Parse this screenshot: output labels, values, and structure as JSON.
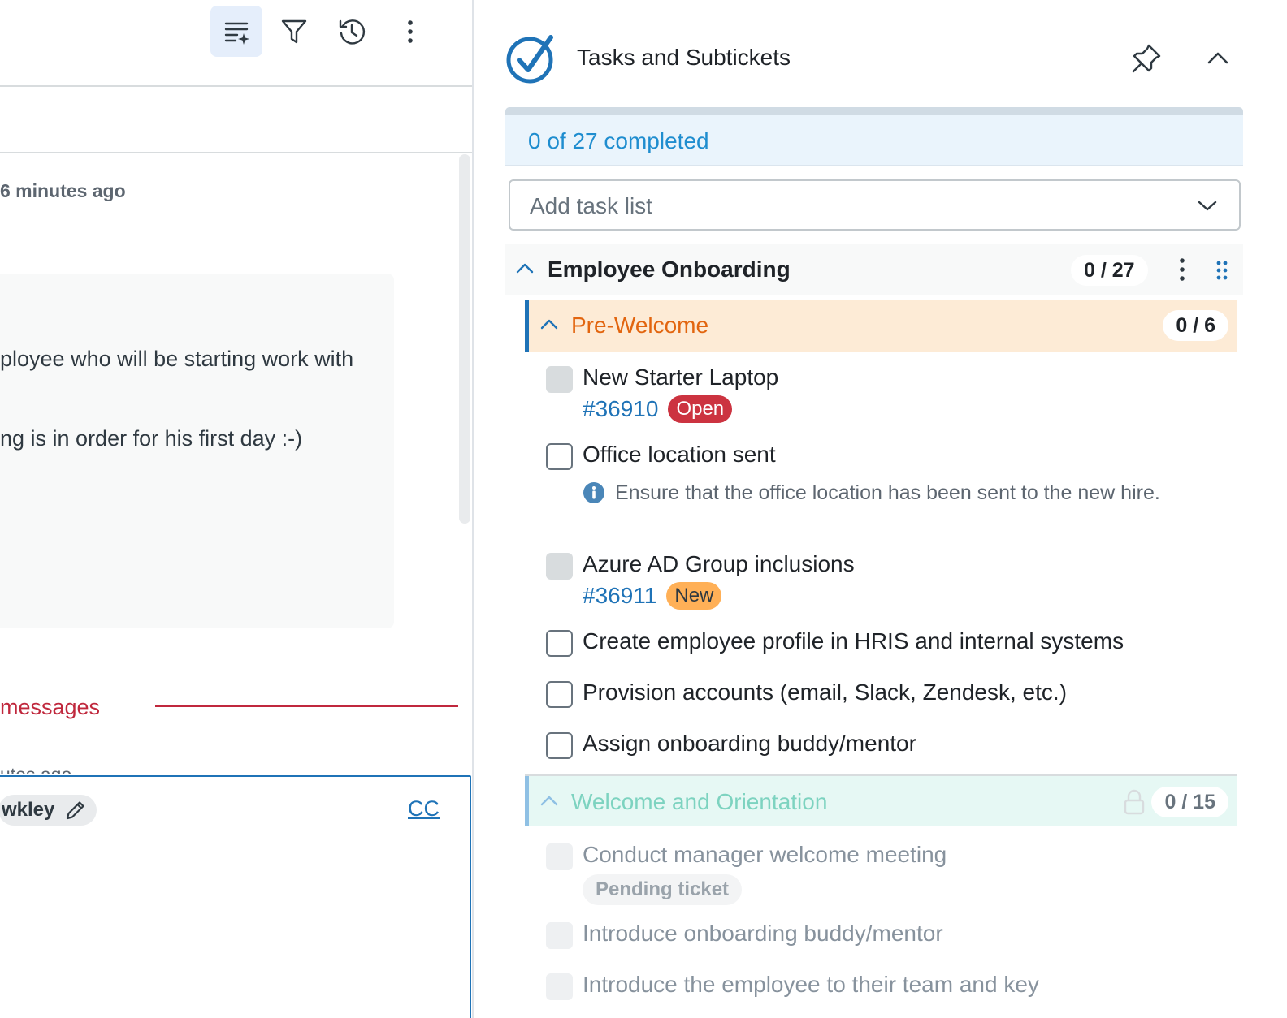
{
  "left": {
    "timestamp": "6 minutes ago",
    "message_lines": [
      "ployee who will be starting work with",
      "ng is in order for his first day :-)"
    ],
    "new_messages_label": "messages",
    "ghost_timestamp": "utes ago",
    "recipient_name": "wkley",
    "cc_label": "CC"
  },
  "header": {
    "title": "Tasks and Subtickets"
  },
  "progress": {
    "text": "0 of 27 completed",
    "completed": 0,
    "total": 27
  },
  "add_task_list": {
    "placeholder": "Add task list"
  },
  "group": {
    "title": "Employee Onboarding",
    "count": "0 / 27"
  },
  "sections": [
    {
      "title": "Pre-Welcome",
      "count": "0 / 6",
      "tasks": [
        {
          "title": "New Starter Laptop",
          "ticket": "#36910",
          "status": "Open"
        },
        {
          "title": "Office location sent",
          "note": "Ensure that the office location has been sent to the new hire."
        },
        {
          "title": "Azure AD Group inclusions",
          "ticket": "#36911",
          "status": "New"
        },
        {
          "title": "Create employee profile in HRIS and internal systems"
        },
        {
          "title": "Provision accounts (email, Slack, Zendesk, etc.)"
        },
        {
          "title": "Assign onboarding buddy/mentor"
        }
      ]
    },
    {
      "title": "Welcome and Orientation",
      "count": "0 / 15",
      "tasks": [
        {
          "title": "Conduct manager welcome meeting",
          "status": "Pending ticket"
        },
        {
          "title": "Introduce onboarding buddy/mentor"
        },
        {
          "title": "Introduce the employee to their team and key"
        }
      ]
    }
  ],
  "colors": {
    "accent": "#1f73b7",
    "open_badge": "#cc3340",
    "new_badge": "#ffb057",
    "pre_welcome_bg": "#fdebd6",
    "pre_welcome_text": "#e2650f",
    "welcome_bg": "#e6f8f4",
    "welcome_text": "#7dd3c0"
  },
  "icons": {
    "toolbar": [
      "ai-summary-icon",
      "filter-icon",
      "history-icon",
      "kebab-menu-icon"
    ],
    "header": [
      "check-circle-logo-icon",
      "pin-icon",
      "chevron-up-icon"
    ]
  }
}
